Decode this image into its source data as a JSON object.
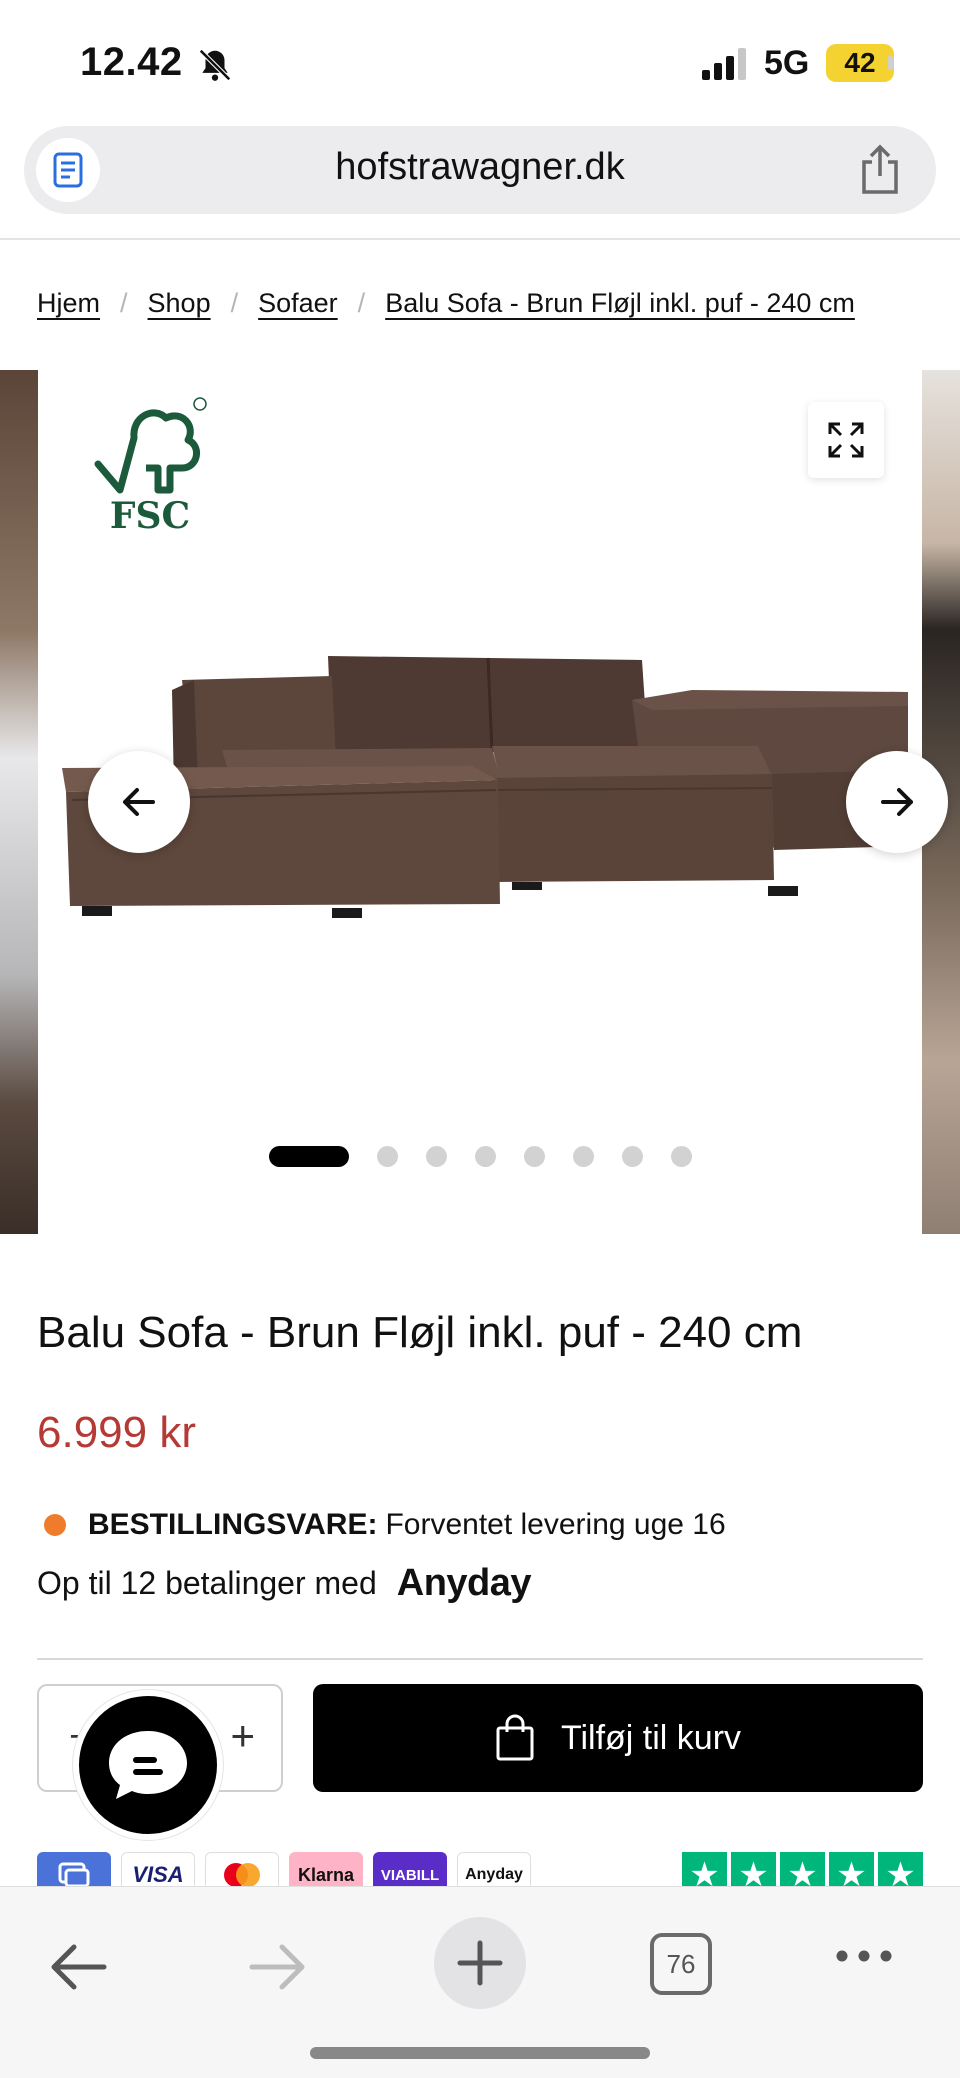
{
  "status_bar": {
    "time": "12.42",
    "network": "5G",
    "battery": "42"
  },
  "browser": {
    "url": "hofstrawagner.dk",
    "tab_count": "76"
  },
  "breadcrumb": [
    {
      "label": "Hjem"
    },
    {
      "label": "Shop"
    },
    {
      "label": "Sofaer"
    },
    {
      "label": "Balu Sofa - Brun Fløjl inkl. puf - 240 cm"
    }
  ],
  "breadcrumb_separator": "/",
  "gallery": {
    "logo_text": "FSC",
    "image_count": 8,
    "active_index": 0
  },
  "product": {
    "title": "Balu Sofa - Brun Fløjl inkl. puf - 240 cm",
    "price": "6.999 kr",
    "delivery_label": "BESTILLINGSVARE:",
    "delivery_text": "Forventet levering uge 16",
    "delivery_status_color": "#ee7c2c",
    "installments_text": "Op til 12 betalinger med",
    "installments_provider": "Anyday",
    "price_color": "#b53a36"
  },
  "cart": {
    "quantity_minus": "−",
    "quantity_plus": "+",
    "add_to_cart_label": "Tilføj til kurv"
  },
  "payments": {
    "visa": "VISA",
    "klarna": "Klarna",
    "viabill": "VIABILL",
    "anyday": "Anyday"
  },
  "trustpilot": {
    "stars": 5,
    "star_glyph": "★"
  },
  "toolbar": {
    "icons": [
      "back-icon",
      "forward-icon",
      "new-tab-icon",
      "tabs-icon",
      "more-icon"
    ]
  }
}
